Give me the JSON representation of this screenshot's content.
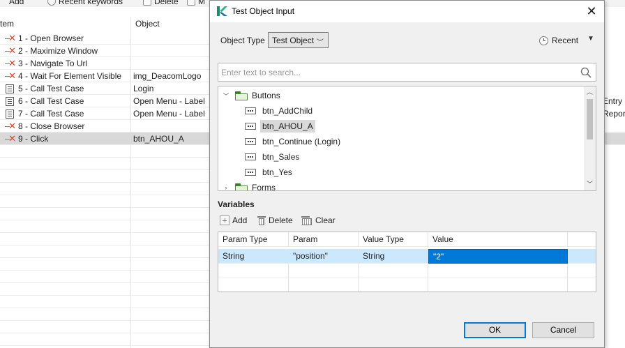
{
  "background": {
    "toolbar": {
      "add_label": "Add",
      "recent_label": "Recent keywords",
      "delete_label": "Delete",
      "more_label": "M"
    },
    "table": {
      "headers": {
        "item": "tem",
        "object": "Object"
      },
      "rows": [
        {
          "item": "1 - Open Browser",
          "object": "",
          "icon": "x-icon"
        },
        {
          "item": "2 - Maximize Window",
          "object": "",
          "icon": "x-icon"
        },
        {
          "item": "3 - Navigate To Url",
          "object": "",
          "icon": "x-icon"
        },
        {
          "item": "4 - Wait For Element Visible",
          "object": "img_DeacomLogo",
          "icon": "x-icon"
        },
        {
          "item": "5 - Call Test Case",
          "object": "Login",
          "icon": "test-case-icon"
        },
        {
          "item": "6 - Call Test Case",
          "object": "Open Menu - Label",
          "icon": "test-case-icon"
        },
        {
          "item": "7 - Call Test Case",
          "object": "Open Menu - Label",
          "icon": "test-case-icon"
        },
        {
          "item": "8 - Close Browser",
          "object": "",
          "icon": "x-icon"
        },
        {
          "item": "9 - Click",
          "object": "btn_AHOU_A",
          "icon": "x-icon",
          "selected": true
        }
      ],
      "side_texts": [
        "Entry",
        "Repor"
      ]
    }
  },
  "dialog": {
    "title": "Test Object Input",
    "object_type_label": "Object Type",
    "object_type_value": "Test Object",
    "recent_label": "Recent",
    "search_placeholder": "Enter text to search...",
    "tree": {
      "folders": [
        "Buttons",
        "Forms"
      ],
      "items": [
        "btn_AddChild",
        "btn_AHOU_A",
        "btn_Continue (Login)",
        "btn_Sales",
        "btn_Yes"
      ],
      "selected_item": "btn_AHOU_A"
    },
    "variables_label": "Variables",
    "var_buttons": {
      "add": "Add",
      "delete": "Delete",
      "clear": "Clear"
    },
    "var_table": {
      "headers": [
        "Param Type",
        "Param",
        "Value Type",
        "Value"
      ],
      "rows": [
        [
          "String",
          "\"position\"",
          "String",
          "\"2\""
        ]
      ]
    },
    "ok_label": "OK",
    "cancel_label": "Cancel"
  },
  "colors": {
    "selection_blue": "#0078d7",
    "row_highlight": "#cce8ff",
    "error_red": "#d0452c",
    "folder_green": "#3a7d2c"
  }
}
